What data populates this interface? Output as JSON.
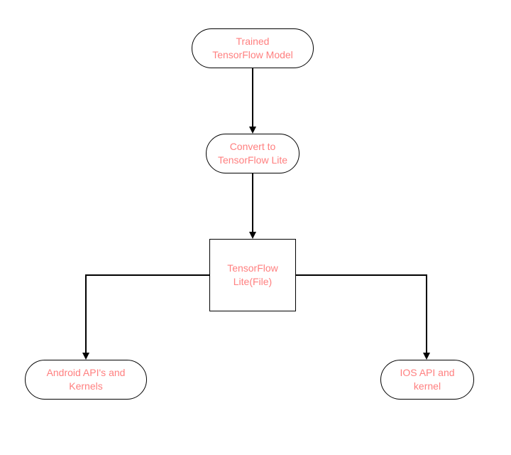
{
  "nodes": {
    "trained": "Trained\nTensorFlow Model",
    "convert": "Convert to\nTensorFlow Lite",
    "litefile": "TensorFlow\nLite(File)",
    "android": "Android API's and\nKernels",
    "ios": "IOS API and\nkernel"
  },
  "colors": {
    "text": "#ff7f7f",
    "border": "#000000"
  }
}
